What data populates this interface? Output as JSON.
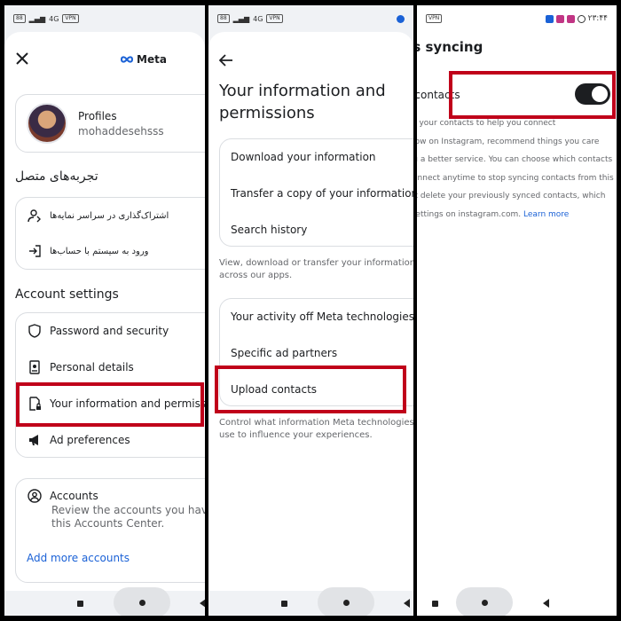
{
  "status_bar": {
    "left_time": "۲۳:۴۴",
    "vpn": "VPN",
    "battery": "88",
    "net": "4G"
  },
  "panel1": {
    "brand": "Meta",
    "profile": {
      "title": "Profiles",
      "username": "mohaddesehsss"
    },
    "connected_heading": "تجربه‌های متصل",
    "connected_items": [
      {
        "label": "اشتراک‌گذاری در سراسر نمایه‌ها"
      },
      {
        "label": "ورود به سیستم با حساب‌ها"
      }
    ],
    "account_settings_heading": "Account settings",
    "settings_items": [
      {
        "label": "Password and security"
      },
      {
        "label": "Personal details"
      },
      {
        "label": "Your information and permissions"
      },
      {
        "label": "Ad preferences"
      }
    ],
    "accounts": {
      "title": "Accounts",
      "description": "Review the accounts you have in this Accounts Center.",
      "add_link": "Add more accounts"
    }
  },
  "panel2": {
    "title": "Your information and permissions",
    "group1": [
      {
        "label": "Download your information"
      },
      {
        "label": "Transfer a copy of your information"
      },
      {
        "label": "Search history"
      }
    ],
    "group1_caption": "View, download or transfer your information across our apps.",
    "group2": [
      {
        "label": "Your activity off Meta technologies"
      },
      {
        "label": "Specific ad partners"
      },
      {
        "label": "Upload contacts"
      }
    ],
    "group2_caption": "Control what information Meta technologies use to influence your experiences."
  },
  "panel3": {
    "title": "Contacts syncing",
    "toggle_label": "Connect contacts",
    "toggle_on": true,
    "description_lines": [
      "We'll securely store your contacts to help you connect",
      "with people you know on Instagram, recommend things you care",
      "about and offer you a better service. You can choose which contacts",
      "to upload and disconnect anytime to stop syncing contacts from this",
      "device. This will not delete your previously synced contacts, which",
      "you can delete in Settings on instagram.com."
    ],
    "learn_more": "Learn more"
  },
  "colors": {
    "highlight": "#c0001a",
    "link": "#1a61d6",
    "toggle": "#1c1e21"
  }
}
